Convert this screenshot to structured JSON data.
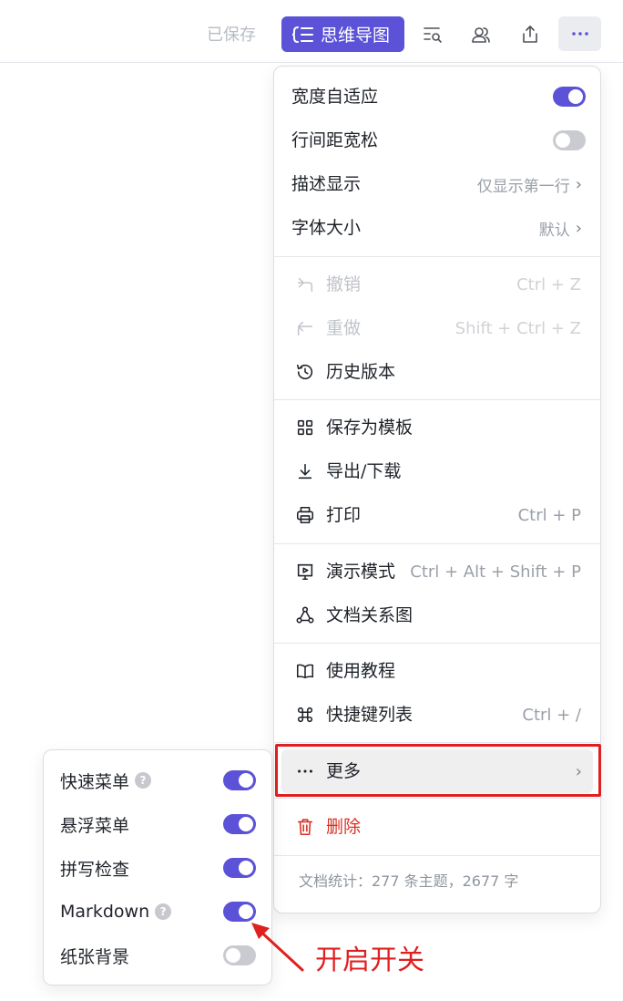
{
  "topbar": {
    "saved_text": "已保存",
    "mindmap_label": "思维导图",
    "icons": [
      "outline-search-icon",
      "collaborators-icon",
      "share-icon",
      "more-icon"
    ]
  },
  "menu": {
    "width_auto": {
      "label": "宽度自适应",
      "on": true
    },
    "line_spacing": {
      "label": "行间距宽松",
      "on": false
    },
    "description": {
      "label": "描述显示",
      "value": "仅显示第一行"
    },
    "font_size": {
      "label": "字体大小",
      "value": "默认"
    },
    "undo": {
      "label": "撤销",
      "shortcut": "Ctrl + Z"
    },
    "redo": {
      "label": "重做",
      "shortcut": "Shift + Ctrl + Z"
    },
    "history": {
      "label": "历史版本"
    },
    "save_template": {
      "label": "保存为模板"
    },
    "export": {
      "label": "导出/下载"
    },
    "print": {
      "label": "打印",
      "shortcut": "Ctrl + P"
    },
    "present": {
      "label": "演示模式",
      "shortcut": "Ctrl + Alt + Shift + P"
    },
    "relation": {
      "label": "文档关系图"
    },
    "tutorial": {
      "label": "使用教程"
    },
    "shortcuts": {
      "label": "快捷键列表",
      "shortcut": "Ctrl + /"
    },
    "more": {
      "label": "更多"
    },
    "delete": {
      "label": "删除"
    },
    "stats": "文档统计：277 条主题，2677 字"
  },
  "submenu": {
    "items": [
      {
        "label": "快速菜单",
        "help": true,
        "on": true
      },
      {
        "label": "悬浮菜单",
        "help": false,
        "on": true
      },
      {
        "label": "拼写检查",
        "help": false,
        "on": true
      },
      {
        "label": "Markdown",
        "help": true,
        "on": true
      },
      {
        "label": "纸张背景",
        "help": false,
        "on": false
      }
    ]
  },
  "annotation": {
    "text": "开启开关"
  },
  "colors": {
    "accent": "#5b52d8",
    "danger": "#d93025",
    "highlight": "#e02020"
  }
}
